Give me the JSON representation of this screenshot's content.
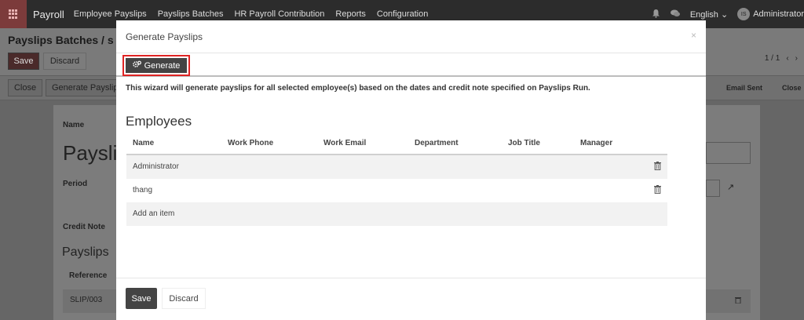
{
  "navbar": {
    "app_name": "Payroll",
    "menu": [
      "Employee Payslips",
      "Payslips Batches",
      "HR Payroll Contribution",
      "Reports",
      "Configuration"
    ],
    "language": "English",
    "avatar_initials": "IS",
    "user": "Administrator"
  },
  "page": {
    "breadcrumb": "Payslips Batches / s",
    "save_label": "Save",
    "discard_label": "Discard",
    "pager": "1 / 1",
    "close_label": "Close",
    "generate_payslips_label": "Generate Payslips",
    "stage_email_sent": "Email Sent",
    "stage_close": "Close",
    "name_label": "Name",
    "name_value": "Payslips",
    "period_label": "Period",
    "credit_note_label": "Credit Note",
    "payslips_section": "Payslips",
    "reference_header": "Reference",
    "slip_ref": "SLIP/003"
  },
  "modal": {
    "title": "Generate Payslips",
    "close_symbol": "×",
    "generate_label": "Generate",
    "description": "This wizard will generate payslips for all selected employee(s) based on the dates and credit note specified on Payslips Run.",
    "employees_title": "Employees",
    "columns": [
      "Name",
      "Work Phone",
      "Work Email",
      "Department",
      "Job Title",
      "Manager"
    ],
    "rows": [
      {
        "name": "Administrator"
      },
      {
        "name": "thang"
      }
    ],
    "add_item_label": "Add an item",
    "save_label": "Save",
    "discard_label": "Discard"
  }
}
